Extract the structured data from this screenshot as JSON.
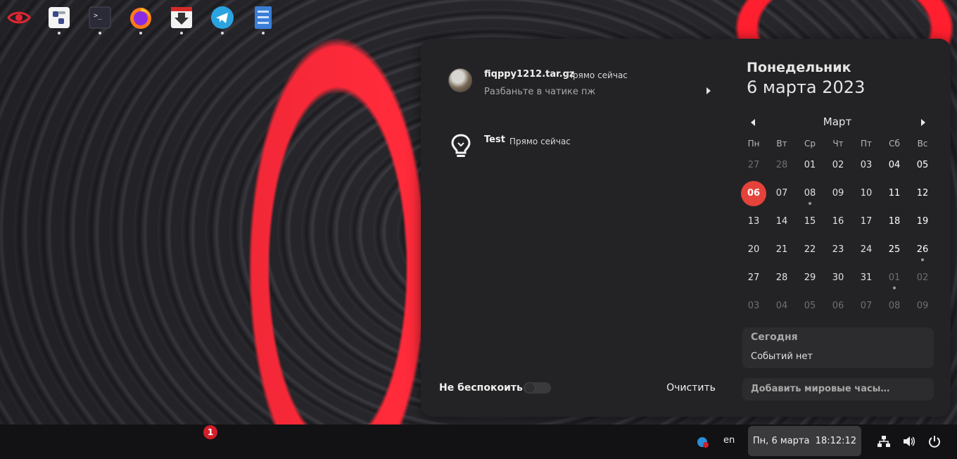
{
  "notifications": [
    {
      "title": "fiqppy1212.tar.gz",
      "time": "Прямо сейчас",
      "body": "Разбаньте в чатике пж"
    },
    {
      "title": "Test",
      "time": "Прямо сейчас",
      "body": ""
    }
  ],
  "dnd": {
    "label": "Не беспокоить",
    "enabled": false
  },
  "clear_label": "Очистить",
  "calendar": {
    "day_name": "Понедельник",
    "full_date": "6 марта 2023",
    "month": "Март",
    "weekdays": [
      "Пн",
      "Вт",
      "Ср",
      "Чт",
      "Пт",
      "Сб",
      "Вс"
    ],
    "weeks": [
      [
        "27",
        "28",
        "01",
        "02",
        "03",
        "04",
        "05"
      ],
      [
        "06",
        "07",
        "08",
        "09",
        "10",
        "11",
        "12"
      ],
      [
        "13",
        "14",
        "15",
        "16",
        "17",
        "18",
        "19"
      ],
      [
        "20",
        "21",
        "22",
        "23",
        "24",
        "25",
        "26"
      ],
      [
        "27",
        "28",
        "29",
        "30",
        "31",
        "01",
        "02"
      ],
      [
        "03",
        "04",
        "05",
        "06",
        "07",
        "08",
        "09"
      ]
    ],
    "today": "06"
  },
  "events": {
    "title": "Сегодня",
    "empty": "Событий нет"
  },
  "world_clocks_label": "Добавить мировые часы…",
  "taskbar": {
    "telegram_badge": "1",
    "lang": "en",
    "clock": "Пн, 6 марта  18:12:12"
  },
  "colors": {
    "accent": "#e5423a",
    "panel": "#232325",
    "taskbar": "#121214"
  }
}
